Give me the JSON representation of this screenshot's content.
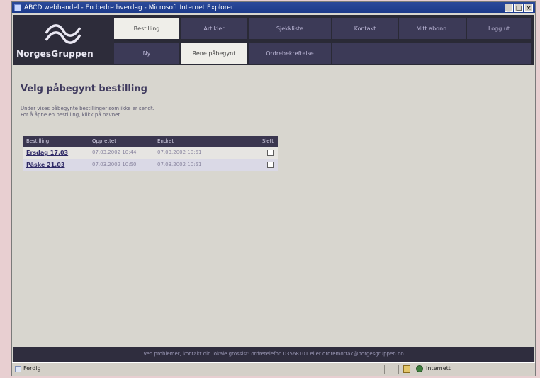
{
  "window": {
    "title": "ABCD webhandel - En bedre hverdag - Microsoft Internet Explorer",
    "controls": [
      "_",
      "□",
      "×"
    ]
  },
  "header": {
    "brand": "NorgesGruppen",
    "nav_row1": [
      "Bestilling",
      "Artikler",
      "Sjekkliste",
      "Kontakt",
      "Mitt abonn.",
      "Logg ut"
    ],
    "nav_row2": [
      "Ny",
      "Rene påbegynt",
      "Ordrebekreftelse"
    ]
  },
  "main": {
    "title": "Velg påbegynt bestilling",
    "intro_line1": "Under vises påbegynte bestillinger som ikke er sendt.",
    "intro_line2": "For å åpne en bestilling, klikk på navnet.",
    "table": {
      "headers": [
        "Bestilling",
        "Opprettet",
        "Endret",
        "Slett"
      ],
      "rows": [
        {
          "name": "Ersdag 17.03",
          "created": "07.03.2002 10:44",
          "changed": "07.03.2002 10:51"
        },
        {
          "name": "Påske 21.03",
          "created": "07.03.2002 10:50",
          "changed": "07.03.2002 10:51"
        }
      ]
    }
  },
  "footer": {
    "text": "Ved problemer, kontakt din lokale grossist: ordretelefon 03568101 eller ordremottak@norgesgruppen.no"
  },
  "statusbar": {
    "left": "Ferdig",
    "zone": "Internett"
  }
}
